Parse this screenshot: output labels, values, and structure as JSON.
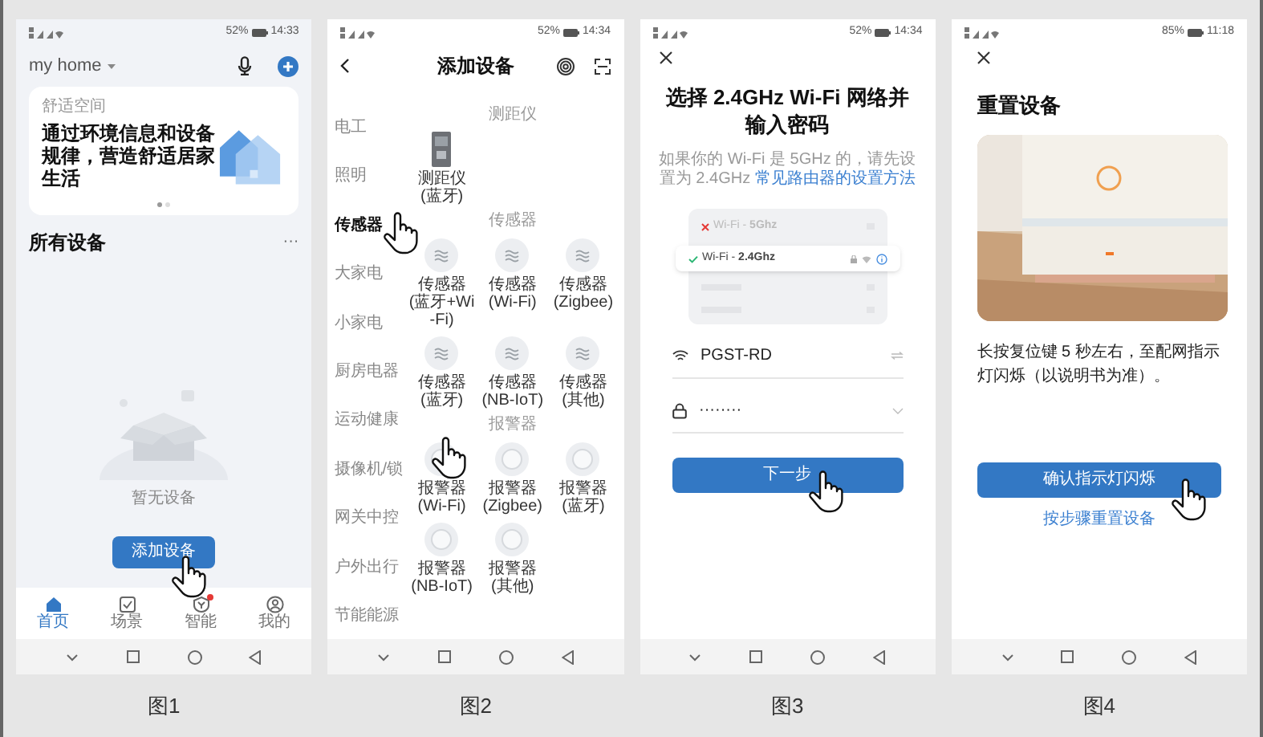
{
  "screens": [
    {
      "kind": "home",
      "caption": "图1",
      "battery": "52%",
      "time": "14:33",
      "title": "my home",
      "banner": {
        "label": "舒适空间",
        "text": "通过环境信息和设备规律，营造舒适居家生活",
        "dots": [
          {
            "selected": true
          },
          {
            "selected": false
          }
        ]
      },
      "section": "所有设备",
      "more": "···",
      "empty_text": "暂无设备",
      "button": "添加设备",
      "tabs": [
        {
          "label": "首页",
          "selected": true,
          "badge": false
        },
        {
          "label": "场景",
          "selected": false,
          "badge": false
        },
        {
          "label": "智能",
          "selected": false,
          "badge": true
        },
        {
          "label": "我的",
          "selected": false,
          "badge": false
        }
      ]
    },
    {
      "kind": "catalog",
      "caption": "图2",
      "battery": "52%",
      "time": "14:34",
      "title": "添加设备",
      "categories": [
        {
          "label": "电工",
          "selected": false
        },
        {
          "label": "照明",
          "selected": false
        },
        {
          "label": "传感器",
          "selected": true
        },
        {
          "label": "大家电",
          "selected": false
        },
        {
          "label": "小家电",
          "selected": false
        },
        {
          "label": "厨房电器",
          "selected": false
        },
        {
          "label": "运动健康",
          "selected": false
        },
        {
          "label": "摄像机/锁",
          "selected": false
        },
        {
          "label": "网关中控",
          "selected": false
        },
        {
          "label": "户外出行",
          "selected": false
        },
        {
          "label": "节能能源",
          "selected": false
        }
      ],
      "sections": [
        {
          "title": "测距仪",
          "items": [
            {
              "kind": "rangefinder",
              "name": "测距仪",
              "variant": "(蓝牙)"
            }
          ]
        },
        {
          "title": "传感器",
          "items": [
            {
              "kind": "sensor",
              "name": "传感器",
              "variant": "(蓝牙+Wi-Fi)"
            },
            {
              "kind": "sensor",
              "name": "传感器",
              "variant": "(Wi-Fi)"
            },
            {
              "kind": "sensor",
              "name": "传感器",
              "variant": "(Zigbee)"
            },
            {
              "kind": "sensor",
              "name": "传感器",
              "variant": "(蓝牙)"
            },
            {
              "kind": "sensor",
              "name": "传感器",
              "variant": "(NB-IoT)"
            },
            {
              "kind": "sensor",
              "name": "传感器",
              "variant": "(其他)"
            }
          ]
        },
        {
          "title": "报警器",
          "items": [
            {
              "kind": "alarm",
              "name": "报警器",
              "variant": "(Wi-Fi)"
            },
            {
              "kind": "alarm",
              "name": "报警器",
              "variant": "(Zigbee)"
            },
            {
              "kind": "alarm",
              "name": "报警器",
              "variant": "(蓝牙)"
            },
            {
              "kind": "alarm",
              "name": "报警器",
              "variant": "(NB-IoT)"
            },
            {
              "kind": "alarm",
              "name": "报警器",
              "variant": "(其他)"
            }
          ]
        }
      ]
    },
    {
      "kind": "wifi",
      "caption": "图3",
      "battery": "52%",
      "time": "14:34",
      "title": "选择 2.4GHz Wi-Fi 网络并输入密码",
      "hint": "如果你的 Wi-Fi 是 5GHz 的，请先设置为 2.4GHz",
      "hint_link": "常见路由器的设置方法",
      "networks": [
        {
          "label": "Wi-Fi - **5Ghz**",
          "supported": false
        },
        {
          "label": "Wi-Fi - **2.4Ghz**",
          "supported": true
        }
      ],
      "ssid": "PGST-RD",
      "password": "········",
      "button": "下一步"
    },
    {
      "kind": "reset",
      "caption": "图4",
      "battery": "85%",
      "time": "11:18",
      "title": "重置设备",
      "description": "长按复位键 5 秒左右，至配网指示灯闪烁（以说明书为准）。",
      "button": "确认指示灯闪烁",
      "link": "按步骤重置设备"
    }
  ]
}
